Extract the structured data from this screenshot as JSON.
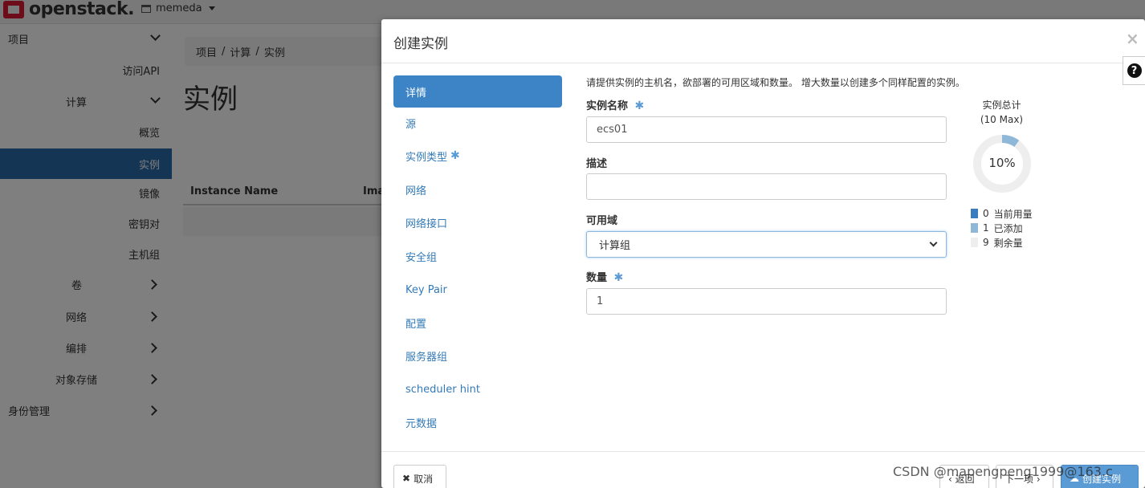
{
  "app": {
    "logo_text": "openstack.",
    "project_name": "memeda"
  },
  "sidebar": {
    "items": [
      {
        "label": "项目"
      },
      {
        "label": "访问API"
      },
      {
        "label": "计算"
      },
      {
        "label": "概览"
      },
      {
        "label": "实例"
      },
      {
        "label": "镜像"
      },
      {
        "label": "密钥对"
      },
      {
        "label": "主机组"
      },
      {
        "label": "卷"
      },
      {
        "label": "网络"
      },
      {
        "label": "编排"
      },
      {
        "label": "对象存储"
      },
      {
        "label": "身份管理"
      }
    ]
  },
  "main": {
    "breadcrumb": [
      "项目",
      "/",
      "计算",
      "/",
      "实例"
    ],
    "page_title": "实例",
    "table_headers": [
      "Instance Name",
      "Ima"
    ]
  },
  "modal": {
    "title": "创建实例",
    "close_glyph": "×",
    "help_glyph": "?",
    "nav": [
      {
        "label": "详情",
        "required": false
      },
      {
        "label": "源",
        "required": false
      },
      {
        "label": "实例类型",
        "required": true
      },
      {
        "label": "网络",
        "required": false
      },
      {
        "label": "网络接口",
        "required": false
      },
      {
        "label": "安全组",
        "required": false
      },
      {
        "label": "Key Pair",
        "required": false
      },
      {
        "label": "配置",
        "required": false
      },
      {
        "label": "服务器组",
        "required": false
      },
      {
        "label": "scheduler hint",
        "required": false
      },
      {
        "label": "元数据",
        "required": false
      }
    ],
    "required_star": "✱",
    "help_text": "请提供实例的主机名，欲部署的可用区域和数量。 增大数量以创建多个同样配置的实例。",
    "fields": {
      "name_label": "实例名称",
      "name_value": "ecs01",
      "desc_label": "描述",
      "desc_value": "",
      "zone_label": "可用域",
      "zone_value": "计算组",
      "count_label": "数量",
      "count_value": "1"
    },
    "quota": {
      "title_line1": "实例总计",
      "title_line2": "(10 Max)",
      "percent_text": "10%",
      "used_fraction": 0.0,
      "added_fraction": 0.1,
      "legend": [
        {
          "count": "0",
          "label": "当前用量",
          "color": "#3a7cc0"
        },
        {
          "count": "1",
          "label": "已添加",
          "color": "#8fb8d8"
        },
        {
          "count": "9",
          "label": "剩余量",
          "color": "#eeeeee"
        }
      ]
    },
    "footer": {
      "cancel_label": "取消",
      "back_label": "‹ 返回",
      "next_label": "下一项 ›",
      "create_label": "创建实例"
    }
  },
  "watermark": "CSDN @mapengpeng1999@163.c",
  "colors": {
    "active_sidebar": "#2b6aa8",
    "active_wizard": "#3c84c6",
    "link": "#337ab7",
    "primary_button": "#5b9bd5"
  }
}
